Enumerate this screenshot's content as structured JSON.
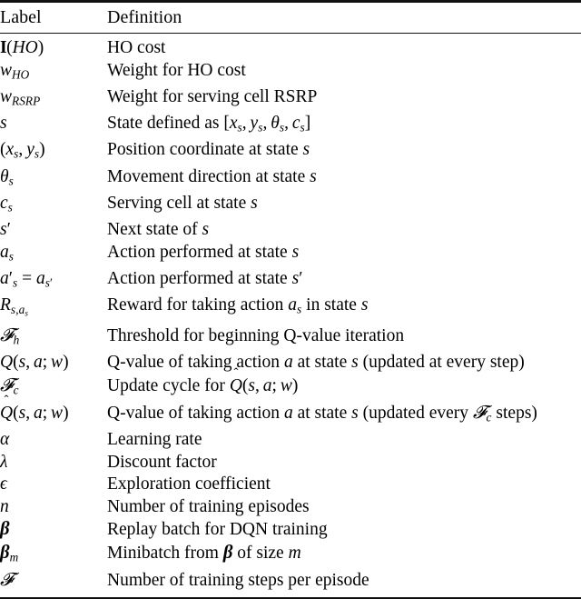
{
  "table": {
    "columns": [
      "Label",
      "Definition"
    ],
    "rows": [
      {
        "label_plain": "I(HO)",
        "definition_plain": "HO cost"
      },
      {
        "label_plain": "w_HO",
        "definition_plain": "Weight for HO cost"
      },
      {
        "label_plain": "w_RSRP",
        "definition_plain": "Weight for serving cell RSRP"
      },
      {
        "label_plain": "s",
        "definition_plain": "State defined as [x_s, y_s, θ_s, c_s]"
      },
      {
        "label_plain": "(x_s, y_s)",
        "definition_plain": "Position coordinate at state s"
      },
      {
        "label_plain": "θ_s",
        "definition_plain": "Movement direction at state s"
      },
      {
        "label_plain": "c_s",
        "definition_plain": "Serving cell at state s"
      },
      {
        "label_plain": "s'",
        "definition_plain": "Next state of s"
      },
      {
        "label_plain": "a_s",
        "definition_plain": "Action performed at state s"
      },
      {
        "label_plain": "a'_s = a_s'",
        "definition_plain": "Action performed at state s'"
      },
      {
        "label_plain": "R_{s,a_s}",
        "definition_plain": "Reward for taking action a_s in state s"
      },
      {
        "label_plain": "T_h",
        "definition_plain": "Threshold for beginning Q-value iteration"
      },
      {
        "label_plain": "Q(s, a; w)",
        "definition_plain": "Q-value of taking action a at state s (updated at every step)"
      },
      {
        "label_plain": "T_c",
        "definition_plain": "Update cycle for Q̂(s, a; w)"
      },
      {
        "label_plain": "Q̂(s, a; w)",
        "definition_plain": "Q-value of taking action a at state s (updated every T_c steps)"
      },
      {
        "label_plain": "α",
        "definition_plain": "Learning rate"
      },
      {
        "label_plain": "λ",
        "definition_plain": "Discount factor"
      },
      {
        "label_plain": "ϵ",
        "definition_plain": "Exploration coefficient"
      },
      {
        "label_plain": "n",
        "definition_plain": "Number of training episodes"
      },
      {
        "label_plain": "β",
        "definition_plain": "Replay batch for DQN training"
      },
      {
        "label_plain": "β_m",
        "definition_plain": "Minibatch from β of size m"
      },
      {
        "label_plain": "T",
        "definition_plain": "Number of training steps per episode"
      }
    ]
  },
  "style": {
    "text_color": "#000000",
    "background_color": "#ffffff",
    "rule_color": "#111111"
  }
}
